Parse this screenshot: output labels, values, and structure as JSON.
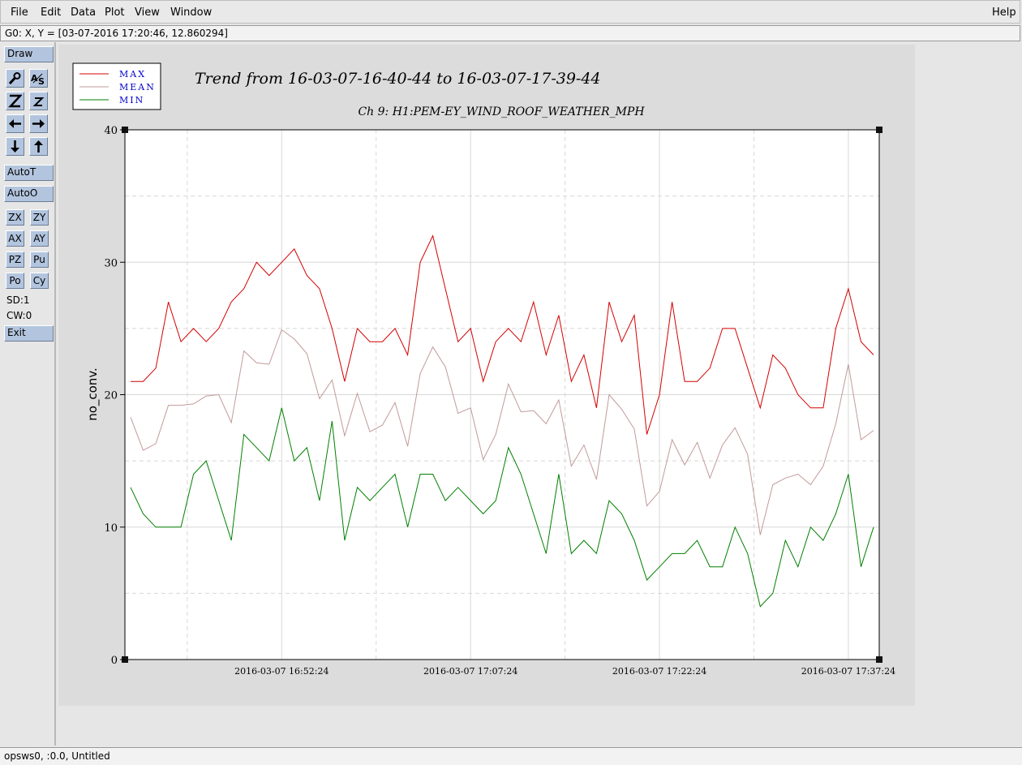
{
  "menubar": {
    "items": [
      "File",
      "Edit",
      "Data",
      "Plot",
      "View",
      "Window"
    ],
    "help": "Help"
  },
  "cursor_readout": "G0: X, Y = [03-07-2016 17:20:46, 12.860294]",
  "toolbar": {
    "draw": "Draw",
    "autot": "AutoT",
    "autoo": "AutoO",
    "zx": "ZX",
    "zy": "ZY",
    "ax": "AX",
    "ay": "AY",
    "pz": "PZ",
    "pu": "Pu",
    "po": "Po",
    "cy": "Cy",
    "sd": "SD:1",
    "cw": "CW:0",
    "exit": "Exit",
    "icon_buttons": [
      "zoom-icon",
      "auto-scale-icon",
      "zoom-in-icon",
      "zoom-out-icon",
      "left-arrow-icon",
      "right-arrow-icon",
      "down-arrow-icon",
      "up-arrow-icon"
    ]
  },
  "status_bottom": "opsws0, :0.0, Untitled",
  "chart_data": {
    "type": "line",
    "title": "Trend from 16-03-07-16-40-44 to 16-03-07-17-39-44",
    "subtitle": "Ch 9: H1:PEM-EY_WIND_ROOF_WEATHER_MPH",
    "xlabel": "",
    "ylabel": "no_conv.",
    "ylim": [
      0,
      40
    ],
    "yticks": [
      0,
      10,
      20,
      30,
      40
    ],
    "xlim": [
      0,
      60
    ],
    "xtick_positions": [
      12,
      27,
      42,
      57
    ],
    "xtick_labels": [
      "2016-03-07 16:52:24",
      "2016-03-07 17:07:24",
      "2016-03-07 17:22:24",
      "2016-03-07 17:37:24"
    ],
    "grid": true,
    "legend_position": "top-left",
    "colors": {
      "MAX": "#d40000",
      "MEAN": "#c29a9a",
      "MIN": "#008000",
      "legend_text": "#0000cc",
      "plot_bg": "#ffffff",
      "panel_bg": "#dcdcdc"
    },
    "x": [
      0,
      1,
      2,
      3,
      4,
      5,
      6,
      7,
      8,
      9,
      10,
      11,
      12,
      13,
      14,
      15,
      16,
      17,
      18,
      19,
      20,
      21,
      22,
      23,
      24,
      25,
      26,
      27,
      28,
      29,
      30,
      31,
      32,
      33,
      34,
      35,
      36,
      37,
      38,
      39,
      40,
      41,
      42,
      43,
      44,
      45,
      46,
      47,
      48,
      49,
      50,
      51,
      52,
      53,
      54,
      55,
      56,
      57,
      58,
      59
    ],
    "series": [
      {
        "name": "MAX",
        "values": [
          21,
          21,
          22,
          27,
          24,
          25,
          24,
          25,
          27,
          28,
          30,
          29,
          30,
          31,
          29,
          28,
          25,
          21,
          25,
          24,
          24,
          25,
          23,
          30,
          32,
          28,
          24,
          25,
          21,
          24,
          25,
          24,
          27,
          23,
          26,
          21,
          23,
          19,
          27,
          24,
          26,
          17,
          20,
          27,
          21,
          21,
          22,
          25,
          25,
          22,
          19,
          23,
          22,
          20,
          19,
          19,
          25,
          28,
          24,
          23
        ]
      },
      {
        "name": "MEAN",
        "values": [
          18.3,
          15.8,
          16.3,
          19.2,
          19.2,
          19.3,
          19.9,
          20,
          17.9,
          23.3,
          22.4,
          22.3,
          24.9,
          24.2,
          23.1,
          19.7,
          21.1,
          16.9,
          20.1,
          17.2,
          17.7,
          19.4,
          16.1,
          21.6,
          23.6,
          22.1,
          18.6,
          19,
          15.1,
          17,
          20.8,
          18.7,
          18.8,
          17.8,
          19.6,
          14.6,
          16.2,
          13.6,
          20,
          18.9,
          17.4,
          11.6,
          12.7,
          16.6,
          14.7,
          16.4,
          13.7,
          16.2,
          17.5,
          15.5,
          9.4,
          13.2,
          13.7,
          14,
          13.2,
          14.6,
          17.8,
          22.3,
          16.6,
          17.3
        ]
      },
      {
        "name": "MIN",
        "values": [
          13,
          11,
          10,
          10,
          10,
          14,
          15,
          12,
          9,
          17,
          16,
          15,
          19,
          15,
          16,
          12,
          18,
          9,
          13,
          12,
          13,
          14,
          10,
          14,
          14,
          12,
          13,
          12,
          11,
          12,
          16,
          14,
          11,
          8,
          14,
          8,
          9,
          8,
          12,
          11,
          9,
          6,
          7,
          8,
          8,
          9,
          7,
          7,
          10,
          8,
          4,
          5,
          9,
          7,
          10,
          9,
          11,
          14,
          7,
          10
        ]
      }
    ]
  }
}
